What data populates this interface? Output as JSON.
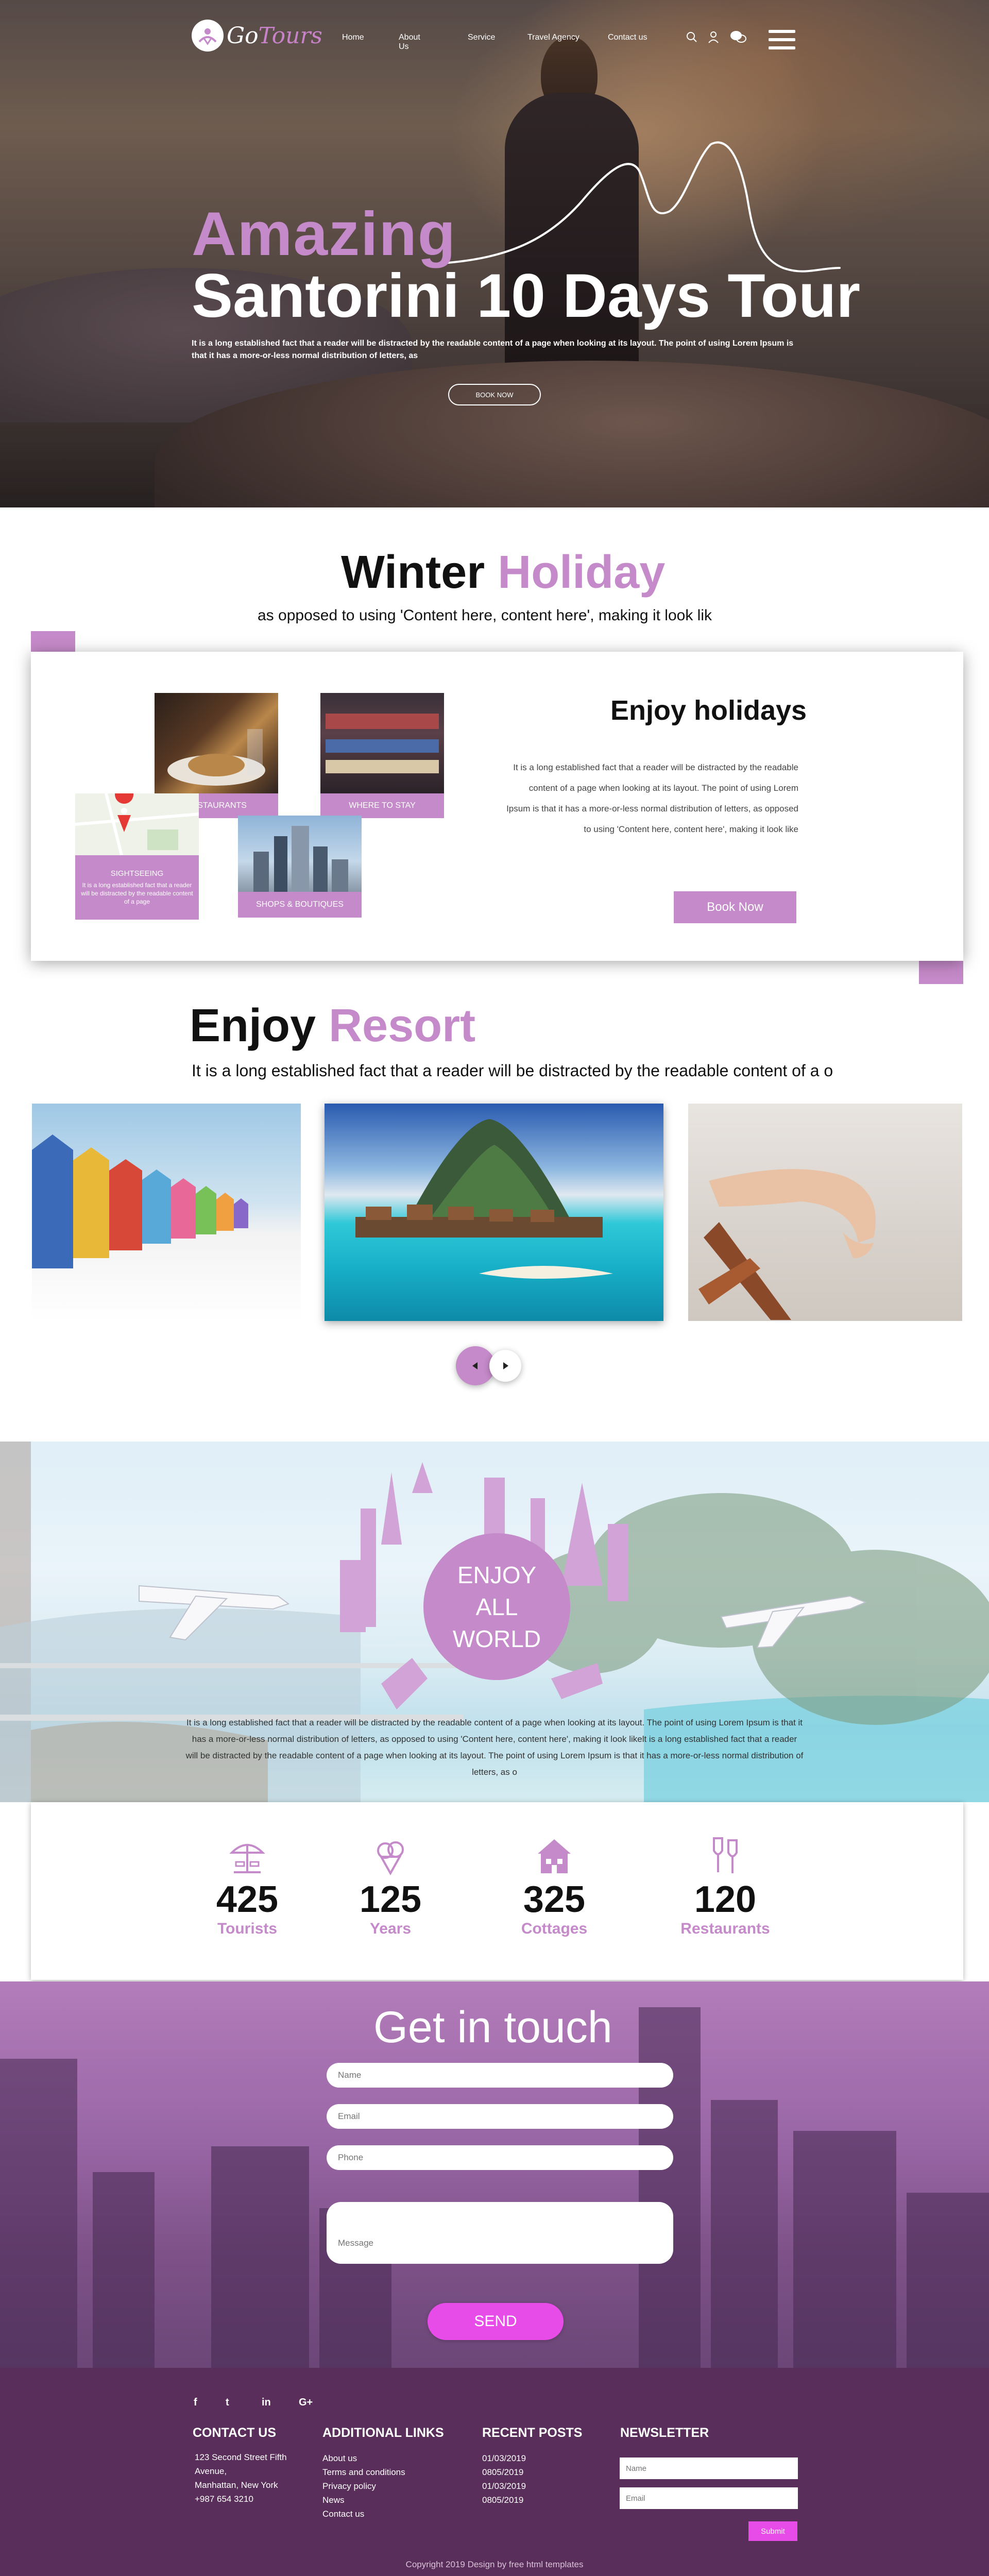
{
  "brand": {
    "logo_go": "Go",
    "logo_tours": "Tours"
  },
  "nav": {
    "items": [
      "Home",
      "About Us",
      "Service",
      "Travel Agency",
      "Contact us"
    ]
  },
  "hero": {
    "amazing": "Amazing",
    "title": "Santorini 10 Days Tour",
    "description": "It is a long established fact that a reader will be distracted by the readable content of a page when looking at its layout. The point of using Lorem Ipsum is that it has a more-or-less normal distribution of letters, as",
    "button": "BOOK NOW"
  },
  "winter": {
    "title_main": "Winter",
    "title_hl": "Holiday",
    "subtitle": "as opposed to using 'Content here, content here', making it look lik",
    "tiles": {
      "restaurants": "RESTAURANTS",
      "where_to_stay": "WHERE TO STAY",
      "sightseeing": "SIGHTSEEING",
      "sightseeing_desc": "It is a long established fact that a reader will be distracted by the readable content of a page",
      "shops": "SHOPS & BOUTIQUES"
    },
    "enjoy_title": "Enjoy holidays",
    "enjoy_text": "It is a long established fact that a reader will be distracted by the readable content of a page when looking at its layout. The point of using Lorem Ipsum is that it has a more-or-less normal distribution of letters, as opposed to using 'Content here, content here', making it look like",
    "book_button": "Book Now"
  },
  "resort": {
    "title_main": "Enjoy",
    "title_hl": "Resort",
    "subtitle": "It is a long established fact that a reader will be distracted by the readable content of a o"
  },
  "world": {
    "circle_lines": [
      "ENJOY",
      "ALL",
      "WORLD"
    ],
    "text": "It is a long established fact that a reader will be distracted by the readable content of a page when looking at its layout. The point of using Lorem Ipsum is that it has a more-or-less normal distribution of letters, as opposed to using 'Content here, content here', making it look likelt is a long established fact that a reader will be distracted by the readable content of a page when looking at its layout. The point of using Lorem Ipsum is that it has a more-or-less normal distribution of letters, as o"
  },
  "stats": [
    {
      "value": "425",
      "label": "Tourists",
      "icon": "beach-umbrella-icon"
    },
    {
      "value": "125",
      "label": "Years",
      "icon": "ice-cream-icon"
    },
    {
      "value": "325",
      "label": "Cottages",
      "icon": "cottage-icon"
    },
    {
      "value": "120",
      "label": "Restaurants",
      "icon": "wine-glasses-icon"
    }
  ],
  "contact": {
    "title": "Get in touch",
    "name_placeholder": "Name",
    "email_placeholder": "Email",
    "phone_placeholder": "Phone",
    "message_placeholder": "Message",
    "send": "SEND"
  },
  "footer": {
    "social": [
      "f",
      "t",
      "in",
      "G+"
    ],
    "contact_us": {
      "heading": "CONTACT US",
      "lines": [
        "123 Second Street Fifth",
        "Avenue,",
        "Manhattan, New York",
        "+987 654 3210"
      ]
    },
    "links": {
      "heading": "ADDITIONAL LINKS",
      "items": [
        "About us",
        "Terms and conditions",
        "Privacy policy",
        "News",
        "Contact us"
      ]
    },
    "posts": {
      "heading": "RECENT POSTS",
      "items": [
        "01/03/2019",
        "0805/2019",
        "01/03/2019",
        "0805/2019"
      ]
    },
    "newsletter": {
      "heading": "NEWSLETTER",
      "name_placeholder": "Name",
      "email_placeholder": "Email",
      "submit": "Submit"
    },
    "copyright": "Copyright 2019  Design by free html templates"
  },
  "colors": {
    "accent": "#c58ac9",
    "send": "#e84ce8",
    "footer_bg": "#5a2e5a"
  }
}
